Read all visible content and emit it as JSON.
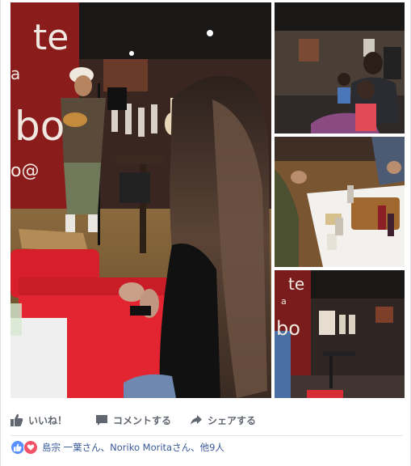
{
  "actions": {
    "like_label": "いいね！",
    "comment_label": "コメントする",
    "share_label": "シェアする"
  },
  "reactions": {
    "summary": "島宗 一葉さん、Noriko Moritaさん、他9人",
    "icons": [
      "like-icon",
      "love-icon"
    ]
  },
  "colors": {
    "action_text": "#606770",
    "link_text": "#385898",
    "like_blue": "#5890ff",
    "love_red": "#f25268",
    "divider": "#e5e6e9"
  },
  "photos": {
    "main_sign_text": "te",
    "main_sign_text2": "a",
    "main_sign_text3": "bo",
    "main_sign_text4": "o@",
    "thumb4_sign_text": "te",
    "thumb4_sign_text2": "a",
    "thumb4_sign_text3": "bo"
  }
}
